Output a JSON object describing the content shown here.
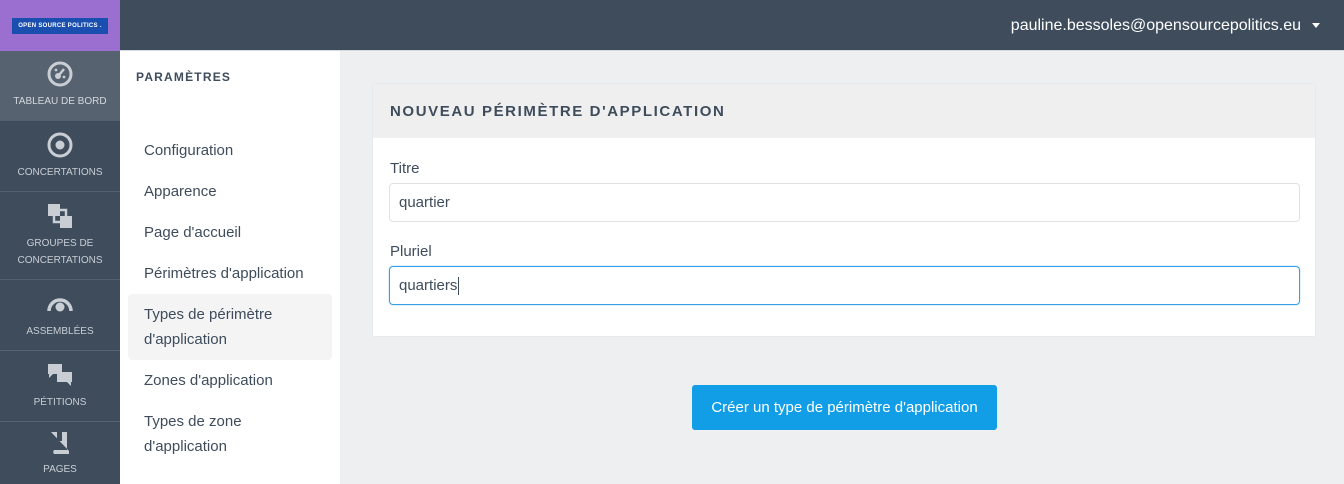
{
  "branding": {
    "logo_text": "OPEN SOURCE POLITICS ."
  },
  "rail": {
    "items": [
      {
        "label": "TABLEAU DE BORD",
        "icon": "dashboard-icon",
        "active": true
      },
      {
        "label": "CONCERTATIONS",
        "icon": "target-icon"
      },
      {
        "label": "GROUPES DE CONCERTATIONS",
        "icon": "layers-icon"
      },
      {
        "label": "ASSEMBLÉES",
        "icon": "assembly-icon"
      },
      {
        "label": "PÉTITIONS",
        "icon": "chat-icon"
      },
      {
        "label": "PAGES",
        "icon": "book-icon"
      }
    ]
  },
  "header": {
    "user_email": "pauline.bessoles@opensourcepolitics.eu"
  },
  "secondary": {
    "title": "PARAMÈTRES",
    "items": [
      {
        "label": "Configuration"
      },
      {
        "label": "Apparence"
      },
      {
        "label": "Page d'accueil"
      },
      {
        "label": "Périmètres d'application"
      },
      {
        "label": "Types de périmètre d'application",
        "active": true
      },
      {
        "label": "Zones d'application"
      },
      {
        "label": "Types de zone d'application"
      }
    ]
  },
  "form": {
    "title": "NOUVEAU PÉRIMÈTRE D'APPLICATION",
    "fields": [
      {
        "label": "Titre",
        "value": "quartier"
      },
      {
        "label": "Pluriel",
        "value": "quartiers"
      }
    ],
    "submit_label": "Créer un type de périmètre d'application"
  },
  "colors": {
    "rail_bg": "#3e4c5c",
    "logo_bg": "#9a6fd0",
    "primary": "#129ee6",
    "focus_border": "#36a0e6"
  }
}
